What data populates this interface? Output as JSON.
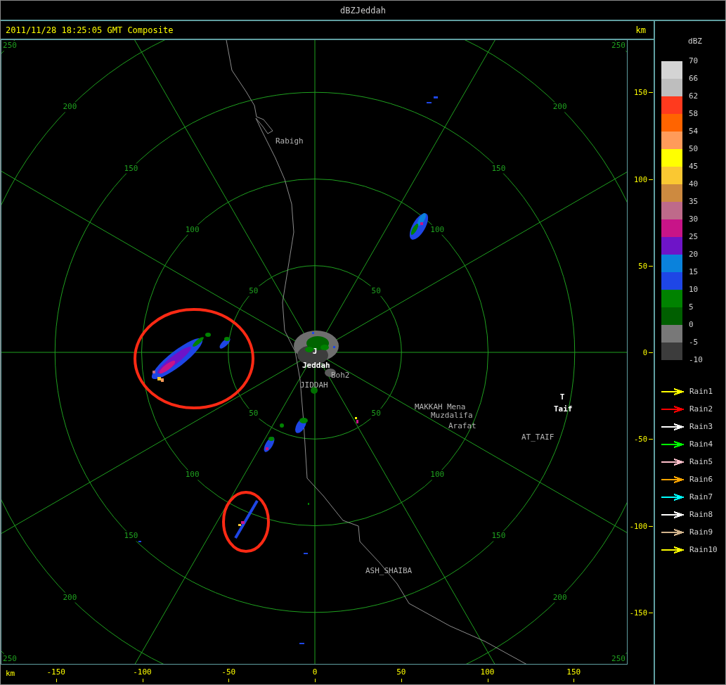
{
  "window": {
    "title": "dBZJeddah"
  },
  "header": {
    "timestamp": "2011/11/28 18:25:05 GMT Composite",
    "unit": "km"
  },
  "map": {
    "range_rings": [
      {
        "labels": [
          "50",
          "50",
          "50",
          "50"
        ]
      },
      {
        "labels": [
          "100",
          "100",
          "100",
          "100"
        ]
      },
      {
        "labels": [
          "150",
          "150",
          "150",
          "150"
        ]
      },
      {
        "labels": [
          "200",
          "200",
          "200",
          "200"
        ]
      },
      {
        "labels": [
          "250",
          "250",
          "250",
          "250"
        ]
      }
    ],
    "places": [
      {
        "name": "Rabigh",
        "kind": "town"
      },
      {
        "name": "J",
        "kind": "site"
      },
      {
        "name": "Jeddah",
        "kind": "site"
      },
      {
        "name": "Boh2",
        "kind": "town"
      },
      {
        "name": "JIDDAH",
        "kind": "town"
      },
      {
        "name": "MAKKAH",
        "kind": "town"
      },
      {
        "name": "Mena",
        "kind": "town"
      },
      {
        "name": "Muzdalifa",
        "kind": "town"
      },
      {
        "name": "Arafat",
        "kind": "town"
      },
      {
        "name": "T",
        "kind": "site"
      },
      {
        "name": "Taif",
        "kind": "site"
      },
      {
        "name": "AT_TAIF",
        "kind": "town"
      },
      {
        "name": "ASH_SHAIBA",
        "kind": "town"
      }
    ]
  },
  "right_axis": {
    "ticks": [
      "150",
      "100",
      "50",
      "0",
      "-50",
      "-100",
      "-150"
    ]
  },
  "bottom_axis": {
    "unit": "km",
    "ticks": [
      "-150",
      "-100",
      "-50",
      "0",
      "50",
      "100",
      "150"
    ]
  },
  "legend": {
    "unit": "dBZ",
    "bands": [
      {
        "label": "70",
        "color": "#d4d4d4"
      },
      {
        "label": "66",
        "color": "#bebebe"
      },
      {
        "label": "62",
        "color": "#ff3a1e"
      },
      {
        "label": "58",
        "color": "#ff6400"
      },
      {
        "label": "54",
        "color": "#ff9b5a"
      },
      {
        "label": "50",
        "color": "#ffff00"
      },
      {
        "label": "45",
        "color": "#fac832"
      },
      {
        "label": "40",
        "color": "#cd8a40"
      },
      {
        "label": "35",
        "color": "#be6a8a"
      },
      {
        "label": "30",
        "color": "#c81488"
      },
      {
        "label": "25",
        "color": "#6e14c8"
      },
      {
        "label": "20",
        "color": "#0a82dc"
      },
      {
        "label": "15",
        "color": "#1e46e6"
      },
      {
        "label": "10",
        "color": "#008200"
      },
      {
        "label": "5",
        "color": "#005f00"
      },
      {
        "label": "0",
        "color": "#787878"
      },
      {
        "label": "-5",
        "color": "#3c3c3c"
      }
    ],
    "bottom_label": "-10",
    "tracks": [
      {
        "label": "Rain1",
        "color": "#ffff00"
      },
      {
        "label": "Rain2",
        "color": "#ff0000"
      },
      {
        "label": "Rain3",
        "color": "#ffffff"
      },
      {
        "label": "Rain4",
        "color": "#00ff00"
      },
      {
        "label": "Rain5",
        "color": "#ffc0cb"
      },
      {
        "label": "Rain6",
        "color": "#ffa500"
      },
      {
        "label": "Rain7",
        "color": "#00ffff"
      },
      {
        "label": "Rain8",
        "color": "#fffffe"
      },
      {
        "label": "Rain9",
        "color": "#d2b48c"
      },
      {
        "label": "Rain10",
        "color": "#fefe00"
      }
    ]
  }
}
